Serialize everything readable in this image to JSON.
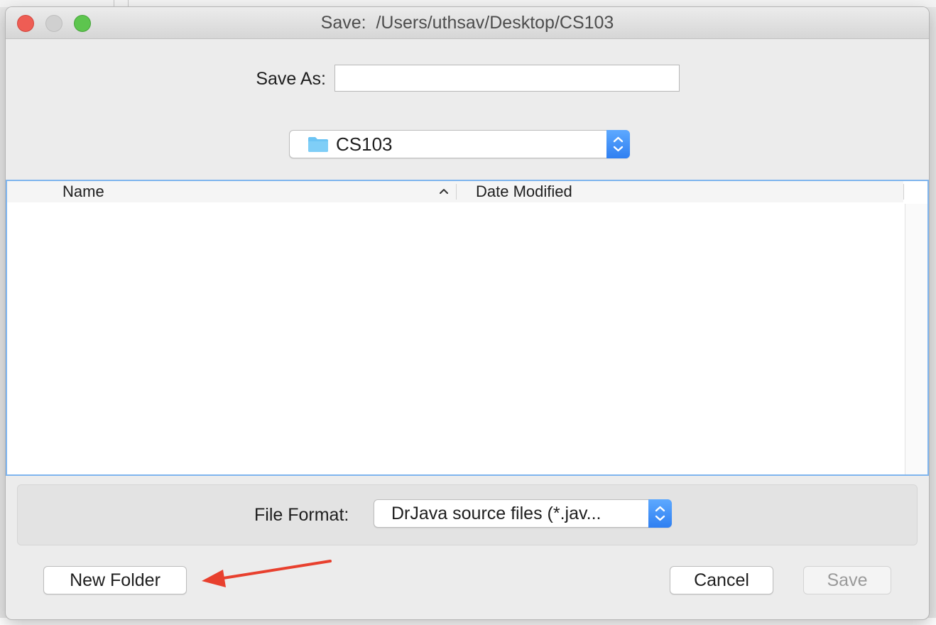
{
  "window": {
    "title": "Save:  /Users/uthsav/Desktop/CS103"
  },
  "save_as": {
    "label": "Save As:",
    "value": ""
  },
  "location": {
    "value": "CS103",
    "icon": "folder-icon"
  },
  "table": {
    "columns": [
      "Name",
      "Date Modified"
    ],
    "sort_indicator": "chevron-up-icon",
    "rows": []
  },
  "file_format": {
    "label": "File Format:",
    "value": "DrJava source files (*.jav..."
  },
  "buttons": {
    "new_folder": "New Folder",
    "cancel": "Cancel",
    "save": "Save"
  },
  "colors": {
    "accent": "#3b8cf5",
    "annotation_arrow": "#e8402e",
    "close": "#ee5d54",
    "maximize": "#5dc54e"
  }
}
